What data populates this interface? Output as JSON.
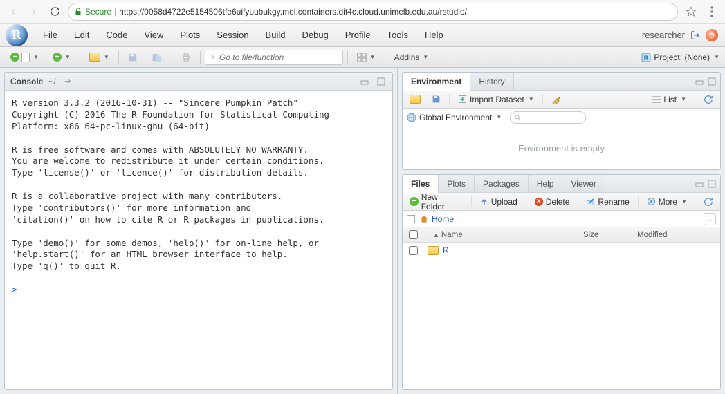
{
  "browser": {
    "secure_label": "Secure",
    "url_host": "https://0058d4722e5154506tfe6uifyuubukgy.mel.containers.dit4c.cloud.unimelb.edu.au",
    "url_path": "/rstudio/"
  },
  "menu": [
    "File",
    "Edit",
    "Code",
    "View",
    "Plots",
    "Session",
    "Build",
    "Debug",
    "Profile",
    "Tools",
    "Help"
  ],
  "user": "researcher",
  "toolbar": {
    "goto_placeholder": "Go to file/function",
    "addins_label": "Addins",
    "project_label": "Project: (None)"
  },
  "console": {
    "title": "Console",
    "path": "~/",
    "text": "R version 3.3.2 (2016-10-31) -- \"Sincere Pumpkin Patch\"\nCopyright (C) 2016 The R Foundation for Statistical Computing\nPlatform: x86_64-pc-linux-gnu (64-bit)\n\nR is free software and comes with ABSOLUTELY NO WARRANTY.\nYou are welcome to redistribute it under certain conditions.\nType 'license()' or 'licence()' for distribution details.\n\nR is a collaborative project with many contributors.\nType 'contributors()' for more information and\n'citation()' on how to cite R or R packages in publications.\n\nType 'demo()' for some demos, 'help()' for on-line help, or\n'help.start()' for an HTML browser interface to help.\nType 'q()' to quit R.\n",
    "prompt": ">"
  },
  "env_pane": {
    "tabs": [
      "Environment",
      "History"
    ],
    "import_label": "Import Dataset",
    "scope_label": "Global Environment",
    "view_label": "List",
    "empty_label": "Environment is empty"
  },
  "files_pane": {
    "tabs": [
      "Files",
      "Plots",
      "Packages",
      "Help",
      "Viewer"
    ],
    "btn_new": "New Folder",
    "btn_upload": "Upload",
    "btn_delete": "Delete",
    "btn_rename": "Rename",
    "btn_more": "More",
    "breadcrumb": "Home",
    "cols": {
      "name": "Name",
      "size": "Size",
      "modified": "Modified"
    },
    "rows": [
      {
        "name": "R",
        "type": "folder",
        "size": "",
        "modified": ""
      }
    ]
  }
}
